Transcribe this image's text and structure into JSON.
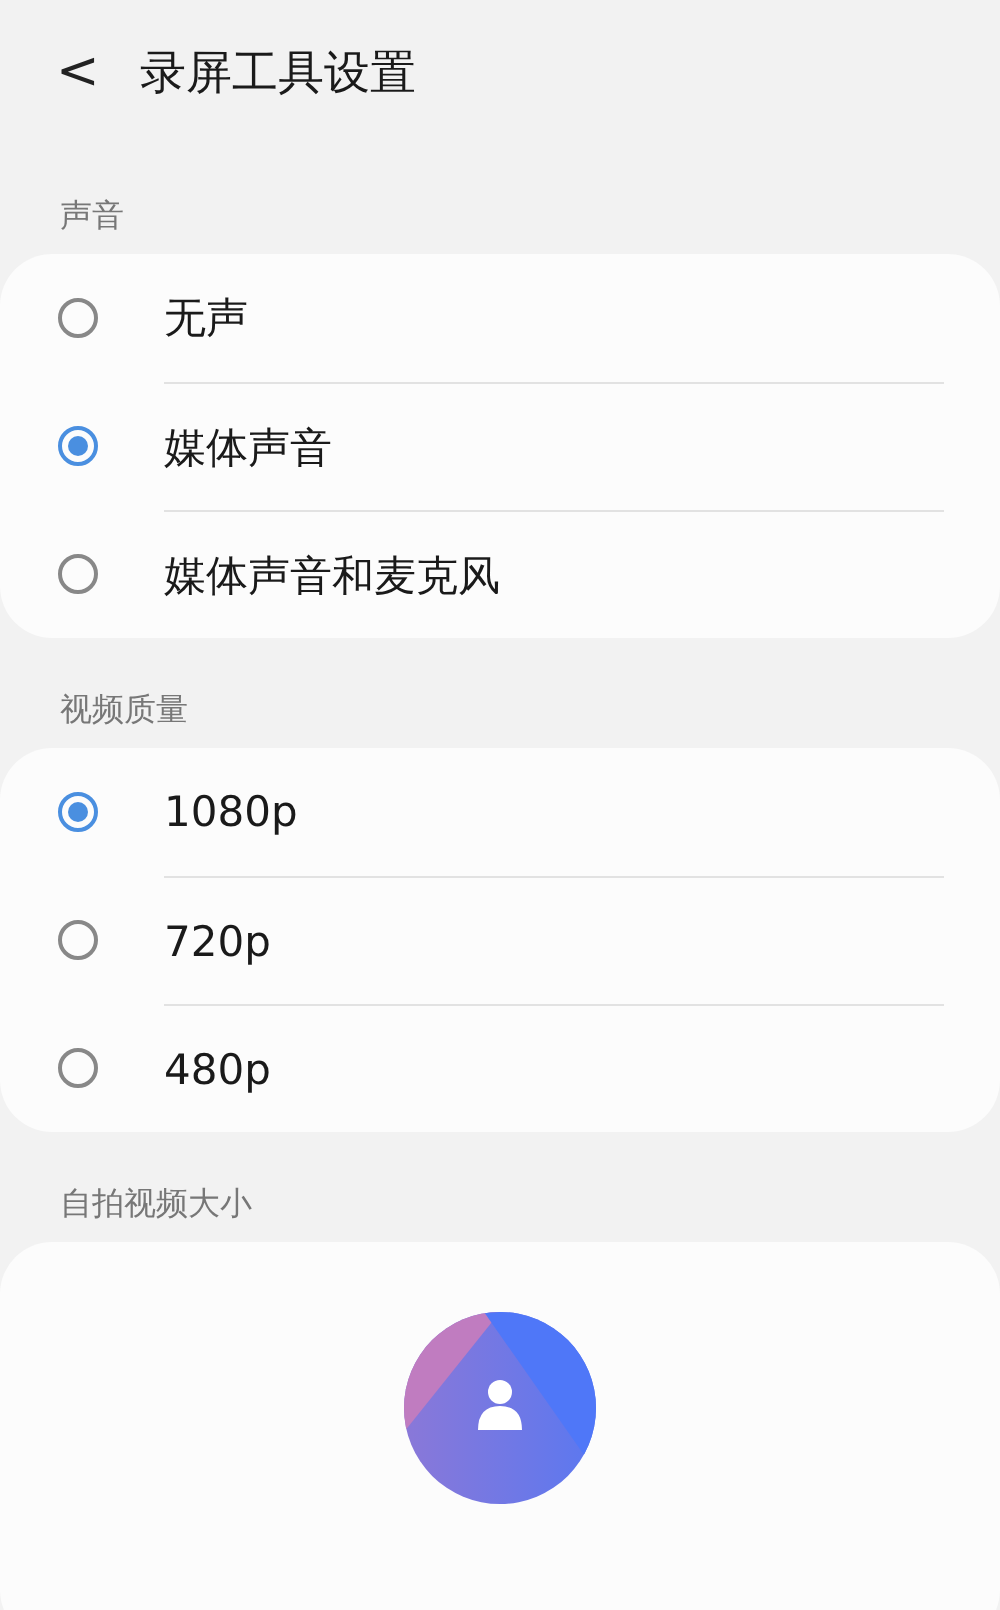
{
  "header": {
    "back": "<",
    "title": "录屏工具设置"
  },
  "sections": [
    {
      "label": "声音",
      "kind": "radio",
      "options": [
        {
          "label": "无声",
          "selected": false
        },
        {
          "label": "媒体声音",
          "selected": true
        },
        {
          "label": "媒体声音和麦克风",
          "selected": false
        }
      ]
    },
    {
      "label": "视频质量",
      "kind": "radio",
      "options": [
        {
          "label": "1080p",
          "selected": true
        },
        {
          "label": "720p",
          "selected": false
        },
        {
          "label": "480p",
          "selected": false
        }
      ]
    },
    {
      "label": "自拍视频大小",
      "kind": "selfie"
    }
  ]
}
